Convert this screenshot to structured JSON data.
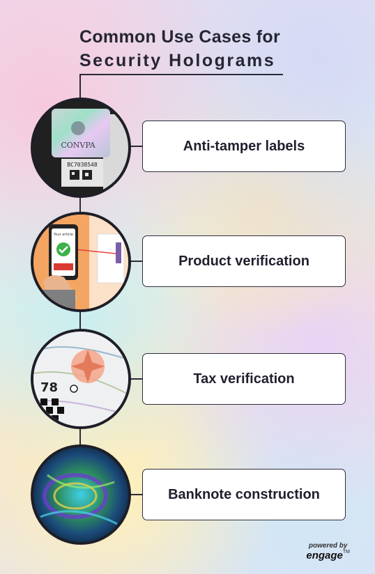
{
  "title": {
    "line1": "Common Use Cases for",
    "line2": "Security  Holograms"
  },
  "items": [
    {
      "label": "Anti-tamper labels",
      "image": "hologram-label-photo"
    },
    {
      "label": "Product verification",
      "image": "phone-scan-photo"
    },
    {
      "label": "Tax verification",
      "image": "tax-stamp-photo"
    },
    {
      "label": "Banknote construction",
      "image": "banknote-hologram-photo"
    }
  ],
  "photo_text": {
    "label_top": "CONVPA",
    "label_serial": "BC7038548",
    "phone_label_top": "Your article",
    "tax_number": "78"
  },
  "footer": {
    "powered_by": "powered by",
    "brand": "engage",
    "tm": "TM"
  },
  "colors": {
    "line": "#2a2a38",
    "card_bg": "#ffffff",
    "accent_green": "#3cb04a"
  }
}
